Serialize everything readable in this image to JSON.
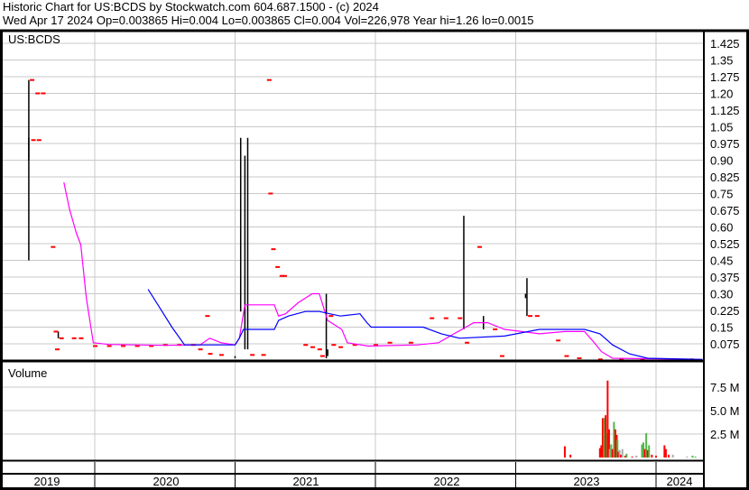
{
  "header": {
    "title": "Historic Chart for US:BCDS by Stockwatch.com 604.687.1500 - (c) 2024",
    "quote": "Wed Apr 17 2024  Op=0.003865  Hi=0.004  Lo=0.003865  Cl=0.004  Vol=226,978  Year hi=1.26  lo=0.0015"
  },
  "chart_data": [
    {
      "type": "line",
      "title": "US:BCDS",
      "ylim": [
        0,
        1.45
      ],
      "yticks": [
        "0.075",
        "0.15",
        "0.225",
        "0.30",
        "0.375",
        "0.45",
        "0.525",
        "0.60",
        "0.675",
        "0.75",
        "0.825",
        "0.90",
        "0.975",
        "1.05",
        "1.125",
        "1.20",
        "1.275",
        "1.35",
        "1.425"
      ],
      "xlabels": [
        "2019",
        "2020",
        "2021",
        "2022",
        "2023",
        "2024"
      ],
      "colors": {
        "ma_fast": "#ff00ff",
        "ma_slow": "#0000ff",
        "price_bar": "#000000",
        "price_tick": "#ff0000"
      },
      "series": [
        {
          "name": "Moving average (short)",
          "color": "#ff00ff",
          "points": [
            [
              2019.78,
              0.8
            ],
            [
              2019.82,
              0.68
            ],
            [
              2019.87,
              0.57
            ],
            [
              2019.9,
              0.52
            ],
            [
              2019.94,
              0.28
            ],
            [
              2019.99,
              0.08
            ],
            [
              2020.1,
              0.072
            ],
            [
              2020.5,
              0.068
            ],
            [
              2020.75,
              0.07
            ],
            [
              2020.82,
              0.1
            ],
            [
              2020.9,
              0.08
            ],
            [
              2021.0,
              0.07
            ],
            [
              2021.03,
              0.1
            ],
            [
              2021.07,
              0.25
            ],
            [
              2021.28,
              0.25
            ],
            [
              2021.31,
              0.2
            ],
            [
              2021.36,
              0.21
            ],
            [
              2021.45,
              0.26
            ],
            [
              2021.55,
              0.3
            ],
            [
              2021.6,
              0.3
            ],
            [
              2021.66,
              0.18
            ],
            [
              2021.76,
              0.14
            ],
            [
              2021.8,
              0.08
            ],
            [
              2021.95,
              0.065
            ],
            [
              2022.3,
              0.07
            ],
            [
              2022.45,
              0.08
            ],
            [
              2022.56,
              0.12
            ],
            [
              2022.7,
              0.17
            ],
            [
              2022.8,
              0.17
            ],
            [
              2022.92,
              0.14
            ],
            [
              2023.17,
              0.12
            ],
            [
              2023.35,
              0.13
            ],
            [
              2023.49,
              0.13
            ],
            [
              2023.56,
              0.08
            ],
            [
              2023.61,
              0.04
            ],
            [
              2023.69,
              0.01
            ],
            [
              2024.33,
              0.005
            ]
          ]
        },
        {
          "name": "Moving average (long)",
          "color": "#0000ff",
          "points": [
            [
              2020.38,
              0.32
            ],
            [
              2020.45,
              0.25
            ],
            [
              2020.55,
              0.15
            ],
            [
              2020.64,
              0.07
            ],
            [
              2021.0,
              0.07
            ],
            [
              2021.03,
              0.1
            ],
            [
              2021.06,
              0.14
            ],
            [
              2021.28,
              0.14
            ],
            [
              2021.31,
              0.18
            ],
            [
              2021.38,
              0.2
            ],
            [
              2021.5,
              0.22
            ],
            [
              2021.6,
              0.22
            ],
            [
              2021.75,
              0.2
            ],
            [
              2021.89,
              0.21
            ],
            [
              2021.94,
              0.17
            ],
            [
              2021.97,
              0.15
            ],
            [
              2022.34,
              0.15
            ],
            [
              2022.47,
              0.12
            ],
            [
              2022.6,
              0.1
            ],
            [
              2022.92,
              0.11
            ],
            [
              2023.17,
              0.14
            ],
            [
              2023.49,
              0.14
            ],
            [
              2023.6,
              0.12
            ],
            [
              2023.69,
              0.07
            ],
            [
              2023.81,
              0.03
            ],
            [
              2023.94,
              0.01
            ],
            [
              2024.33,
              0.005
            ]
          ]
        }
      ],
      "hilo_bars": [
        [
          2019.53,
          1.26,
          0.45
        ],
        [
          2019.53,
          1.0,
          0.9
        ],
        [
          2019.74,
          0.13,
          0.1
        ],
        [
          2021.0,
          0.01,
          0.02
        ],
        [
          2021.04,
          1.0,
          0.22
        ],
        [
          2021.07,
          0.92,
          0.05
        ],
        [
          2021.09,
          1.0,
          0.05
        ],
        [
          2021.65,
          0.3,
          0.01
        ],
        [
          2021.66,
          0.05,
          0.02
        ],
        [
          2022.63,
          0.65,
          0.14
        ],
        [
          2022.77,
          0.2,
          0.14
        ],
        [
          2023.08,
          0.37,
          0.2
        ],
        [
          2023.07,
          0.3,
          0.28
        ]
      ],
      "price_ticks": [
        [
          2019.55,
          1.26
        ],
        [
          2019.59,
          1.2
        ],
        [
          2019.63,
          1.2
        ],
        [
          2019.56,
          0.99
        ],
        [
          2019.6,
          0.99
        ],
        [
          2019.7,
          0.51
        ],
        [
          2019.72,
          0.13
        ],
        [
          2019.76,
          0.1
        ],
        [
          2019.85,
          0.1
        ],
        [
          2019.73,
          0.05
        ],
        [
          2019.9,
          0.1
        ],
        [
          2020.0,
          0.065
        ],
        [
          2020.1,
          0.065
        ],
        [
          2020.2,
          0.065
        ],
        [
          2020.3,
          0.065
        ],
        [
          2020.4,
          0.065
        ],
        [
          2020.5,
          0.07
        ],
        [
          2020.6,
          0.07
        ],
        [
          2020.7,
          0.07
        ],
        [
          2020.8,
          0.2
        ],
        [
          2020.75,
          0.05
        ],
        [
          2020.82,
          0.03
        ],
        [
          2020.9,
          0.025
        ],
        [
          2021.12,
          0.025
        ],
        [
          2021.2,
          0.025
        ],
        [
          2021.24,
          1.26
        ],
        [
          2021.25,
          0.75
        ],
        [
          2021.27,
          0.5
        ],
        [
          2021.3,
          0.42
        ],
        [
          2021.33,
          0.38
        ],
        [
          2021.35,
          0.38
        ],
        [
          2021.5,
          0.07
        ],
        [
          2021.55,
          0.06
        ],
        [
          2021.6,
          0.05
        ],
        [
          2021.62,
          0.02
        ],
        [
          2021.68,
          0.2
        ],
        [
          2021.7,
          0.07
        ],
        [
          2021.75,
          0.06
        ],
        [
          2021.85,
          0.07
        ],
        [
          2022.0,
          0.07
        ],
        [
          2022.1,
          0.08
        ],
        [
          2022.25,
          0.08
        ],
        [
          2022.4,
          0.19
        ],
        [
          2022.5,
          0.19
        ],
        [
          2022.6,
          0.19
        ],
        [
          2022.65,
          0.08
        ],
        [
          2022.74,
          0.51
        ],
        [
          2022.85,
          0.14
        ],
        [
          2022.9,
          0.02
        ],
        [
          2023.1,
          0.2
        ],
        [
          2023.15,
          0.2
        ],
        [
          2023.3,
          0.09
        ],
        [
          2023.36,
          0.02
        ],
        [
          2023.45,
          0.01
        ],
        [
          2023.6,
          0.005
        ],
        [
          2023.75,
          0.005
        ],
        [
          2023.9,
          0.005
        ],
        [
          2024.1,
          0.005
        ],
        [
          2024.25,
          0.005
        ]
      ]
    },
    {
      "type": "bar",
      "title": "Volume",
      "ylabel": "Volume",
      "ylim": [
        0,
        9.6
      ],
      "yticks": [
        "2.5 M",
        "5.0 M",
        "7.5 M"
      ],
      "unit": "M",
      "colors": {
        "down": "#ff0000",
        "up": "#50b848",
        "flat": "#aaaaaa"
      },
      "bars": [
        [
          2023.35,
          1.2,
          "down"
        ],
        [
          2023.39,
          0.3,
          "down"
        ],
        [
          2023.6,
          1.0,
          "down"
        ],
        [
          2023.61,
          1.3,
          "down"
        ],
        [
          2023.62,
          4.2,
          "down"
        ],
        [
          2023.63,
          4.2,
          "up"
        ],
        [
          2023.64,
          4.5,
          "down"
        ],
        [
          2023.65,
          2.6,
          "up"
        ],
        [
          2023.655,
          8.2,
          "down"
        ],
        [
          2023.665,
          3.0,
          "down"
        ],
        [
          2023.67,
          0.9,
          "flat"
        ],
        [
          2023.68,
          1.4,
          "up"
        ],
        [
          2023.69,
          0.9,
          "down"
        ],
        [
          2023.7,
          3.8,
          "up"
        ],
        [
          2023.71,
          3.0,
          "down"
        ],
        [
          2023.72,
          2.4,
          "down"
        ],
        [
          2023.725,
          1.9,
          "up"
        ],
        [
          2023.73,
          0.6,
          "down"
        ],
        [
          2023.74,
          0.8,
          "flat"
        ],
        [
          2023.75,
          0.3,
          "down"
        ],
        [
          2023.76,
          0.9,
          "flat"
        ],
        [
          2023.78,
          0.2,
          "down"
        ],
        [
          2023.79,
          0.4,
          "up"
        ],
        [
          2023.83,
          0.1,
          "down"
        ],
        [
          2023.86,
          0.2,
          "flat"
        ],
        [
          2023.9,
          1.4,
          "up"
        ],
        [
          2023.91,
          1.6,
          "up"
        ],
        [
          2023.92,
          0.9,
          "down"
        ],
        [
          2023.93,
          2.6,
          "up"
        ],
        [
          2023.94,
          0.8,
          "down"
        ],
        [
          2023.95,
          1.3,
          "up"
        ],
        [
          2023.97,
          0.3,
          "down"
        ],
        [
          2024.0,
          0.2,
          "down"
        ],
        [
          2024.06,
          1.3,
          "down"
        ],
        [
          2024.07,
          0.9,
          "down"
        ],
        [
          2024.09,
          0.3,
          "down"
        ],
        [
          2024.12,
          0.3,
          "flat"
        ],
        [
          2024.22,
          0.1,
          "flat"
        ],
        [
          2024.26,
          0.2,
          "up"
        ],
        [
          2024.28,
          0.1,
          "up"
        ]
      ]
    }
  ]
}
